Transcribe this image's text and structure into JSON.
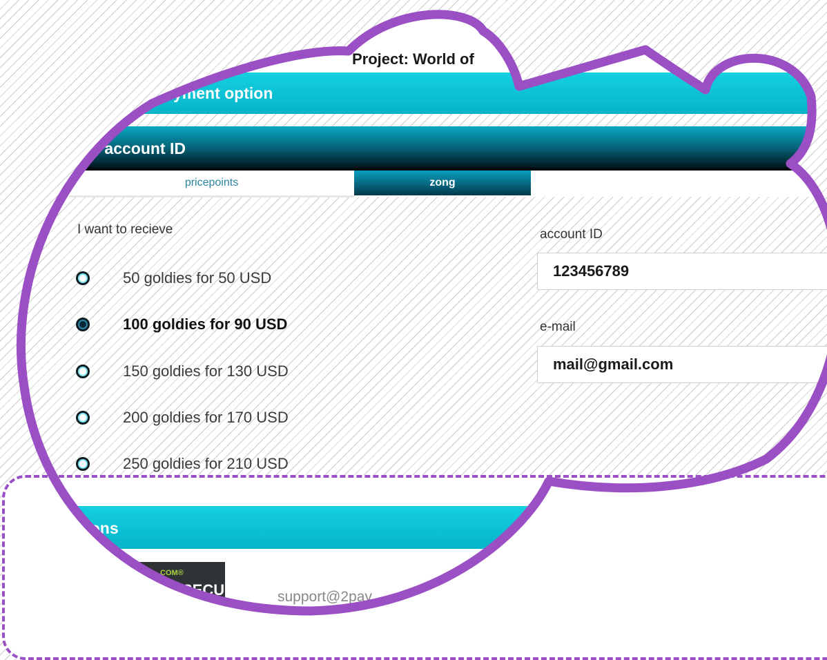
{
  "page": {
    "project_title": "Project: World of",
    "payment_option_label": "Select payment option",
    "account_bar_label": "Enter your account ID",
    "tabs": [
      {
        "label": "pricepoints",
        "active": false
      },
      {
        "label": "zong",
        "active": true
      }
    ],
    "receive_label": "I want to recieve",
    "options": [
      {
        "label": "50 goldies for 50 USD",
        "selected": false
      },
      {
        "label": "100 goldies for 90 USD",
        "selected": true
      },
      {
        "label": "150 goldies for 130 USD",
        "selected": false
      },
      {
        "label": "200 goldies for 170 USD",
        "selected": false
      },
      {
        "label": "250 goldies for 210 USD",
        "selected": false
      }
    ],
    "account_id_label": "account ID",
    "account_id_value": "123456789",
    "email_label": "e-mail",
    "email_value": "mail@gmail.com",
    "instructions_label": "Instructions",
    "secured_badge": {
      "line1": "COM®",
      "line2": "SECURED"
    },
    "support_text": "support@2pay"
  },
  "colors": {
    "accent_cyan": "#0ac3d6",
    "frame_purple": "#9b4fc4",
    "active_tab_dark": "#04394a"
  }
}
